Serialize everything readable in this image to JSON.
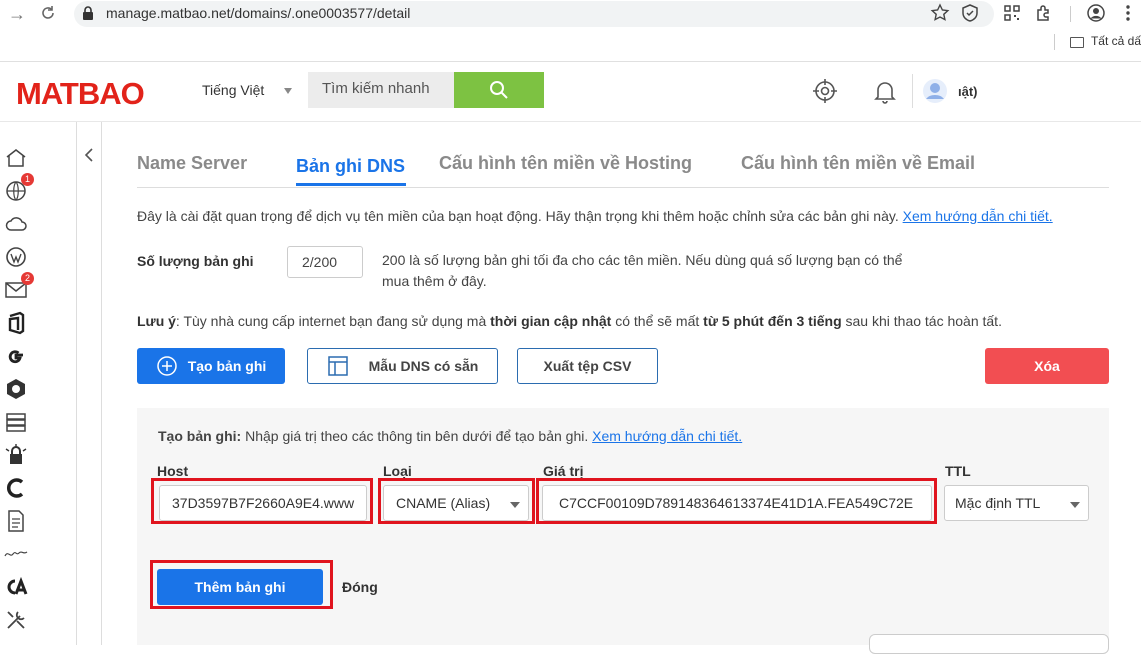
{
  "browser": {
    "url": "manage.matbao.net/domains/.one0003577/detail",
    "bookmarks_label": "Tất cả dấ"
  },
  "header": {
    "logo": "MATBAO",
    "language": "Tiếng Việt",
    "search_placeholder": "Tìm kiếm nhanh",
    "user_name": "ıật)"
  },
  "sidebar": {
    "globe_badge": "1",
    "mail_badge": "2"
  },
  "tabs": [
    "Name Server",
    "Bản ghi DNS",
    "Cấu hình tên miền về Hosting",
    "Cấu hình tên miền về Email"
  ],
  "intro": {
    "text": "Đây là cài đặt quan trọng để dịch vụ tên miền của bạn hoạt động. Hãy thận trọng khi thêm hoặc chỉnh sửa các bản ghi này.",
    "link": "Xem hướng dẫn chi tiết."
  },
  "record_count": {
    "label": "Số lượng bản ghi",
    "value": "2/200",
    "note": "200 là số lượng bản ghi tối đa cho các tên miền. Nếu dùng quá số lượng bạn có thể mua thêm ở đây."
  },
  "note": {
    "prefix": "Lưu ý",
    "part1": ": Tùy nhà cung cấp internet bạn đang sử dụng mà ",
    "bold1": "thời gian cập nhật",
    "part2": " có thể sẽ mất ",
    "bold2": "từ 5 phút đến 3 tiếng",
    "part3": " sau khi thao tác hoàn tất."
  },
  "actions": {
    "create": "Tạo bản ghi",
    "template": "Mẫu DNS có sẵn",
    "export": "Xuất tệp CSV",
    "delete": "Xóa"
  },
  "form": {
    "intro_bold": "Tạo bản ghi:",
    "intro_text": " Nhập giá trị theo các thông tin bên dưới để tạo bản ghi. ",
    "intro_link": "Xem hướng dẫn chi tiết.",
    "host_label": "Host",
    "host_value": "37D3597B7F2660A9E4.www",
    "type_label": "Loại",
    "type_value": "CNAME (Alias)",
    "value_label": "Giá trị",
    "value_value": "C7CCF00109D789148364613374E41D1A.FEA549C72E",
    "ttl_label": "TTL",
    "ttl_value": "Mặc định TTL",
    "submit": "Thêm bản ghi",
    "close": "Đóng"
  }
}
